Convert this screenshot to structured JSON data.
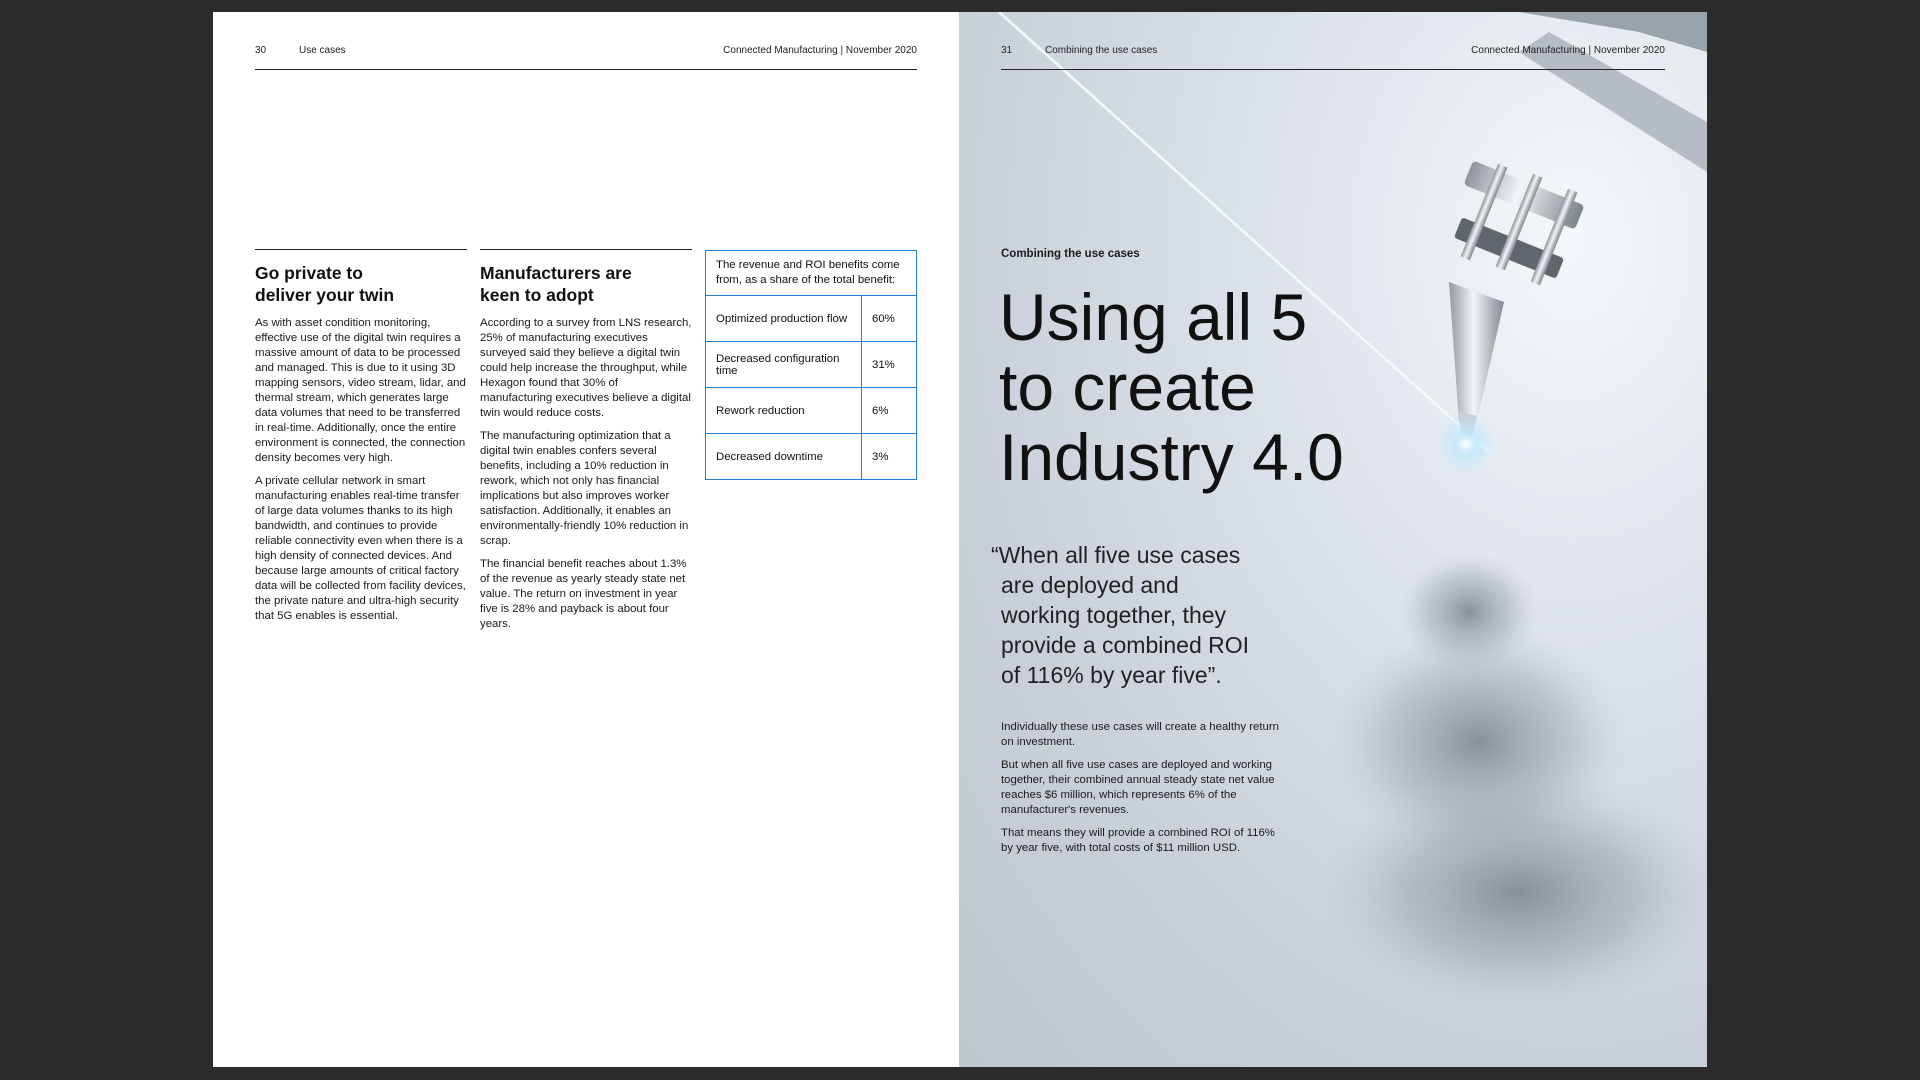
{
  "left_page": {
    "page_number": "30",
    "section": "Use cases",
    "document": "Connected Manufacturing  |  November 2020",
    "column1": {
      "heading_lines": [
        "Go private to",
        "deliver your twin"
      ],
      "paragraphs": [
        "As with asset condition monitoring, effective use of the digital twin requires a massive amount of data to be processed and managed. This is due to it using 3D mapping sensors, video stream, lidar, and thermal stream, which generates large data volumes that need to be transferred in real-time. Additionally, once the entire environment is connected, the connection density becomes very high.",
        "A private cellular network in smart manufacturing enables real-time transfer of large data volumes thanks to its high bandwidth, and continues to provide reliable connectivity even when there is a high density of connected devices. And because large amounts of critical factory data will be collected from facility devices, the private nature and ultra-high security that 5G enables is essential."
      ]
    },
    "column2": {
      "heading_lines": [
        "Manufacturers are",
        "keen to adopt"
      ],
      "paragraphs": [
        "According to a survey from LNS research, 25% of manufacturing executives surveyed said they believe a digital twin could help increase the throughput, while Hexagon found that 30% of manufacturing executives believe a digital twin would reduce costs.",
        "The manufacturing optimization that a digital twin enables confers several benefits, including a 10% reduction in rework, which not only has financial implications but also improves worker satisfaction. Additionally, it enables an environmentally-friendly 10% reduction in scrap.",
        "The financial benefit reaches about 1.3% of the revenue as yearly steady state net value. The return on investment in year five is 28% and payback is about four years."
      ]
    },
    "benefit_table": {
      "caption": "The revenue and ROI benefits come from, as a share of the total benefit:",
      "rows": [
        {
          "label": "Optimized production flow",
          "value": "60%"
        },
        {
          "label": "Decreased configuration time",
          "value": "31%"
        },
        {
          "label": "Rework reduction",
          "value": "6%"
        },
        {
          "label": "Decreased downtime",
          "value": "3%"
        }
      ]
    }
  },
  "right_page": {
    "page_number": "31",
    "section": "Combining the use cases",
    "document": "Connected Manufacturing  |  November 2020",
    "kicker": "Combining the use cases",
    "headline_lines": [
      "Using all 5",
      "to create",
      "Industry 4.0"
    ],
    "quote_lines": [
      "“When all five use cases",
      "are deployed and",
      "working together, they",
      "provide a combined ROI",
      "of 116% by year five”."
    ],
    "paragraphs": [
      "Individually these use cases will create a healthy return on investment.",
      "But when all five use cases are deployed and working together, their combined annual steady state net value reaches $6 million, which represents 6% of the manufacturer's revenues.",
      "That means they will provide a combined ROI of 116% by year five, with total costs of $11 million USD."
    ]
  }
}
